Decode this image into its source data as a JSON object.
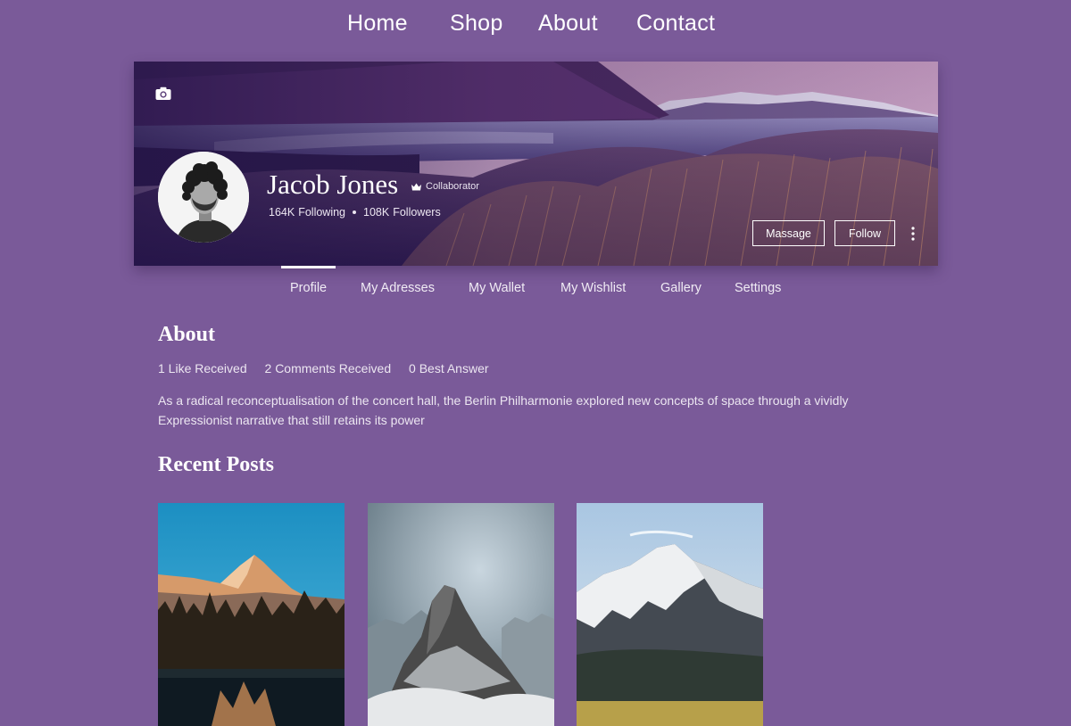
{
  "nav": {
    "home": "Home",
    "shop": "Shop",
    "about": "About",
    "contact": "Contact"
  },
  "profile": {
    "name": "Jacob Jones",
    "badge": "Collaborator",
    "following_count": "164K",
    "following_label": "Following",
    "followers_count": "108K",
    "followers_label": "Followers",
    "message_button": "Massage",
    "follow_button": "Follow"
  },
  "tabs": [
    {
      "label": "Profile",
      "active": true
    },
    {
      "label": "My Adresses"
    },
    {
      "label": "My Wallet"
    },
    {
      "label": "My Wishlist"
    },
    {
      "label": "Gallery"
    },
    {
      "label": "Settings"
    }
  ],
  "about": {
    "title": "About",
    "likes": "1 Like Received",
    "comments": "2 Comments Received",
    "answers": "0 Best Answer",
    "description": "As a radical reconceptualisation of the concert hall, the Berlin Philharmonie explored new concepts of space through a vividly Expressionist narrative that still retains its power"
  },
  "recent_posts": {
    "title": "Recent Posts",
    "count": 3
  },
  "colors": {
    "background": "#7a5a99",
    "text": "#ffffff",
    "muted_text": "#ece6f1"
  },
  "icons": [
    "camera-icon",
    "crown-icon",
    "more-vertical-icon"
  ]
}
